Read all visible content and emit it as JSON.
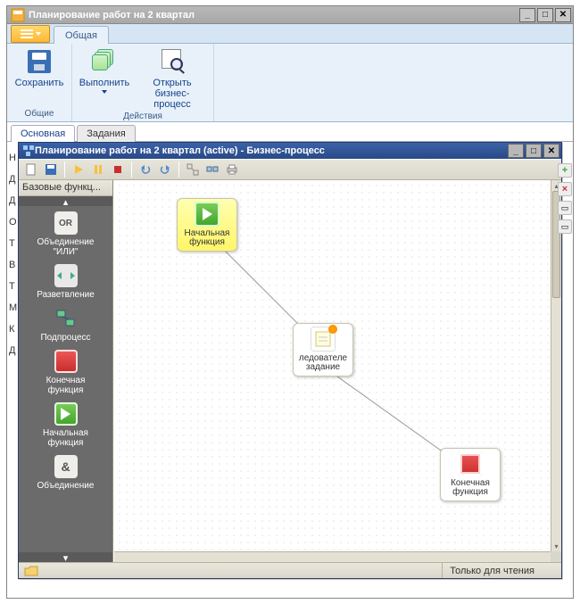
{
  "outer": {
    "title": "Планирование работ на 2 квартал"
  },
  "ribbon": {
    "tab": "Общая",
    "group1": "Общие",
    "group2": "Действия",
    "save": "Сохранить",
    "run": "Выполнить",
    "open_bp_l1": "Открыть",
    "open_bp_l2": "бизнес-процесс"
  },
  "subtabs": {
    "main": "Основная",
    "tasks": "Задания"
  },
  "inner": {
    "title": "Планирование работ на 2 квартал (active) - Бизнес-процесс",
    "palette_header": "Базовые функц...",
    "status_text": "Только для чтения"
  },
  "palette": {
    "or_l1": "Объединение",
    "or_l2": "\"ИЛИ\"",
    "or_text": "OR",
    "branch": "Разветвление",
    "sub": "Подпроцесс",
    "end_l1": "Конечная",
    "end_l2": "функция",
    "start_l1": "Начальная",
    "start_l2": "функция",
    "and_text": "&",
    "and_l1": "Объединение"
  },
  "nodes": {
    "start_l1": "Начальная",
    "start_l2": "функция",
    "task_l1": "ледователе",
    "task_l2": "задание",
    "end_l1": "Конечная",
    "end_l2": "функция"
  },
  "bg_rows": [
    "Н",
    "Д",
    "Д",
    "О",
    "Т",
    "В",
    "Т",
    "М",
    "",
    "К",
    "",
    "Д"
  ]
}
